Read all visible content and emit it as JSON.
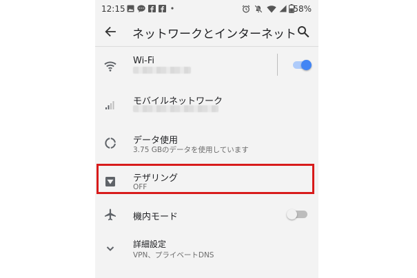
{
  "status_bar": {
    "time": "12:15",
    "battery_pct": "58%"
  },
  "app_bar": {
    "title": "ネットワークとインターネット",
    "back_icon": "arrow-left-icon",
    "search_icon": "search-icon"
  },
  "settings": [
    {
      "id": "wifi",
      "title": "Wi-Fi",
      "subtitle": "",
      "icon": "wifi-icon",
      "toggle": true,
      "toggle_on": true
    },
    {
      "id": "mobile",
      "title": "モバイルネットワーク",
      "subtitle": "",
      "icon": "signal-icon"
    },
    {
      "id": "data",
      "title": "データ使用",
      "subtitle": "3.75 GBのデータを使用しています",
      "icon": "data-usage-icon"
    },
    {
      "id": "tethering",
      "title": "テザリング",
      "subtitle": "OFF",
      "icon": "hotspot-icon",
      "highlighted": true
    },
    {
      "id": "airplane",
      "title": "機内モード",
      "subtitle": "",
      "icon": "airplane-icon",
      "toggle": true,
      "toggle_on": false
    },
    {
      "id": "advanced",
      "title": "詳細設定",
      "subtitle": "VPN、プライベートDNS",
      "icon": "chevron-down-icon"
    }
  ],
  "colors": {
    "accent": "#4285f4",
    "accent_track": "#aecbfa",
    "highlight": "#d81b1b",
    "background": "#f3f3f3"
  }
}
